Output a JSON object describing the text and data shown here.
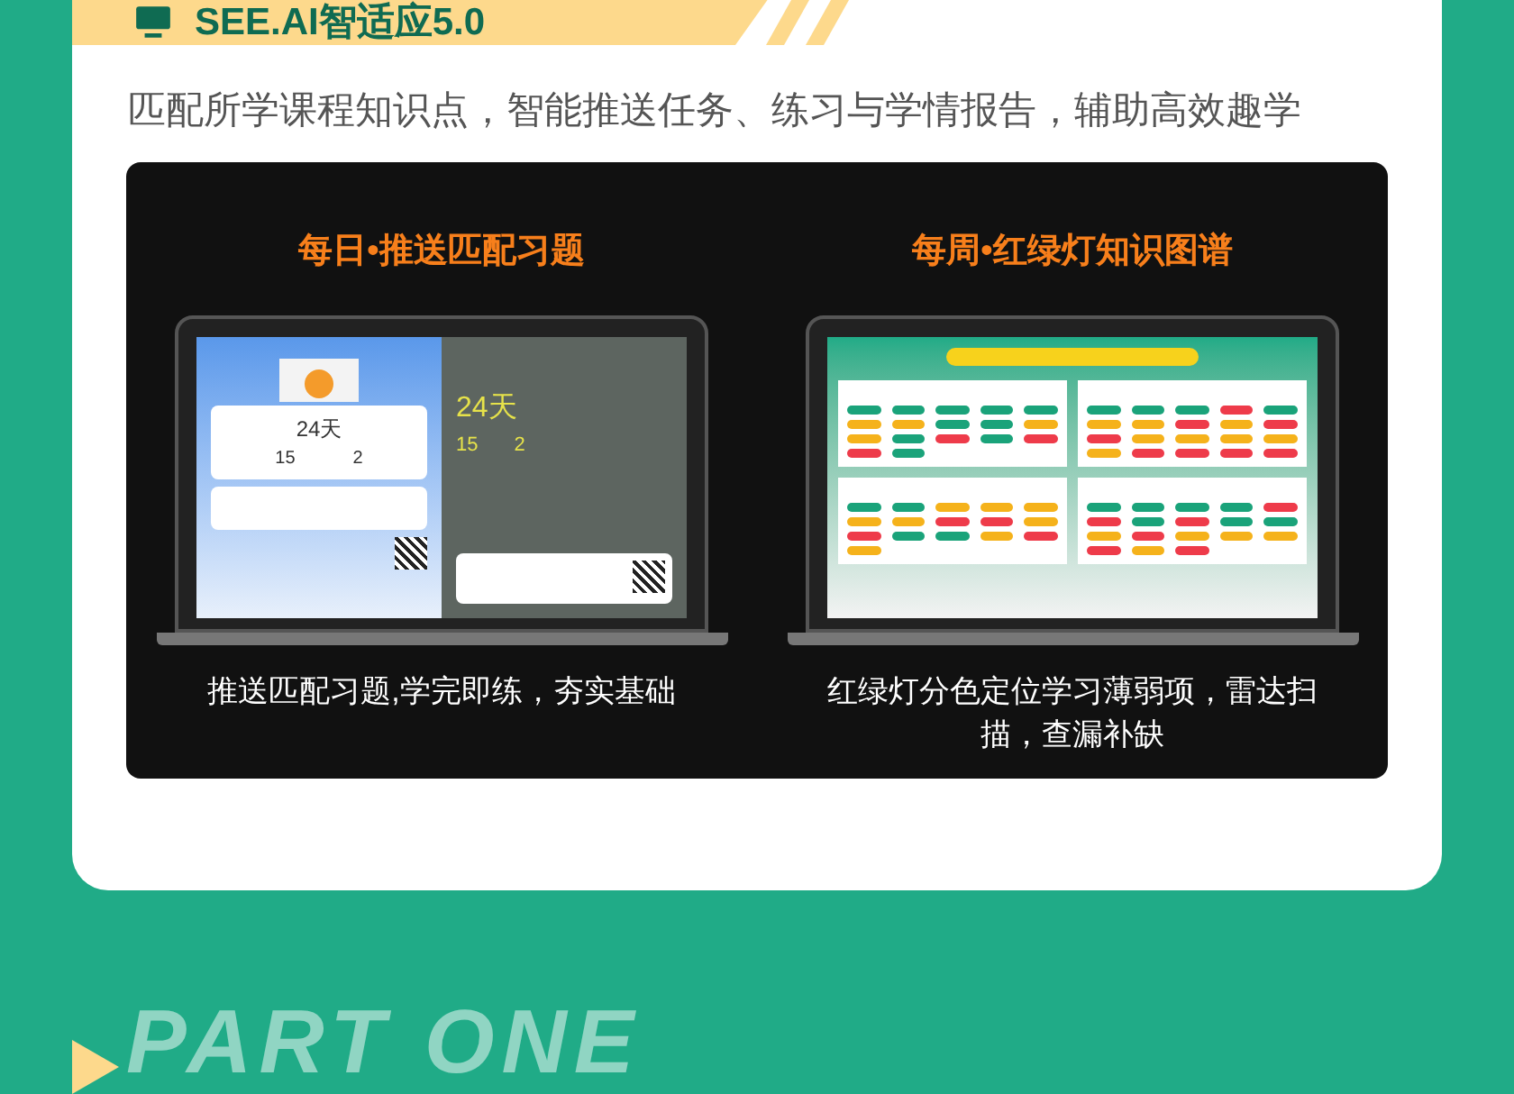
{
  "banner": {
    "title": "SEE.AI智适应5.0"
  },
  "intro": "匹配所学课程知识点，智能推送任务、练习与学情报告，辅助高效趣学",
  "features": [
    {
      "kind": "daily",
      "title": "每日•推送匹配习题",
      "screen": {
        "card_days": "24天",
        "card_stat_1": "15",
        "card_stat_2": "2",
        "photo_days": "24天",
        "photo_stat_1": "15",
        "photo_stat_2": "2"
      },
      "caption": "推送匹配习题,学完即练，夯实基础"
    },
    {
      "kind": "weekly",
      "title": "每周•红绿灯知识图谱",
      "caption": "红绿灯分色定位学习薄弱项，雷达扫描，查漏补缺"
    }
  ],
  "section": {
    "watermark": "PART ONE"
  }
}
